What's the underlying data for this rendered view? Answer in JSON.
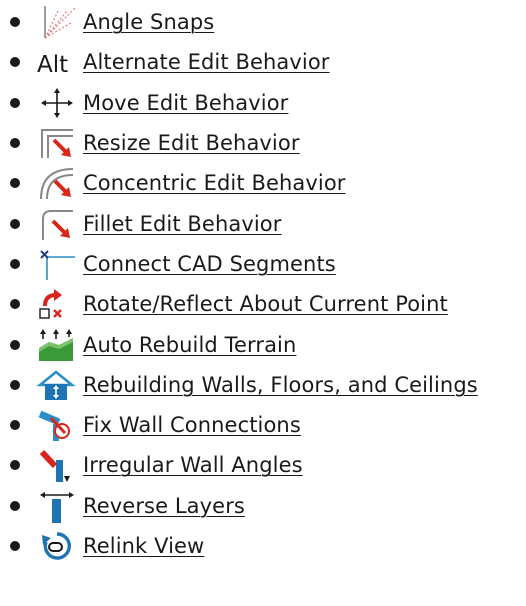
{
  "items": [
    {
      "label": "Angle Snaps",
      "icon": "angle-snaps-icon"
    },
    {
      "label": "Alternate Edit Behavior",
      "icon": "alternate-edit-icon",
      "icon_text": "Alt"
    },
    {
      "label": "Move Edit Behavior",
      "icon": "move-arrows-icon"
    },
    {
      "label": "Resize Edit Behavior",
      "icon": "resize-edit-icon"
    },
    {
      "label": "Concentric Edit Behavior",
      "icon": "concentric-edit-icon"
    },
    {
      "label": "Fillet Edit Behavior",
      "icon": "fillet-edit-icon"
    },
    {
      "label": "Connect CAD Segments",
      "icon": "connect-cad-icon"
    },
    {
      "label": "Rotate/Reflect About Current Point",
      "icon": "rotate-reflect-icon"
    },
    {
      "label": "Auto Rebuild Terrain",
      "icon": "terrain-icon"
    },
    {
      "label": "Rebuilding Walls, Floors, and Ceilings",
      "icon": "house-rebuild-icon"
    },
    {
      "label": "Fix Wall Connections",
      "icon": "fix-wall-icon"
    },
    {
      "label": "Irregular Wall Angles",
      "icon": "irregular-wall-icon"
    },
    {
      "label": "Reverse Layers",
      "icon": "reverse-layers-icon"
    },
    {
      "label": "Relink View",
      "icon": "relink-view-icon"
    }
  ],
  "colors": {
    "text": "#1a1a1a",
    "accent_red": "#d9261c",
    "accent_blue": "#1f74b5",
    "accent_green": "#3a9a3a",
    "cad_cyan": "#2a8fc7"
  }
}
